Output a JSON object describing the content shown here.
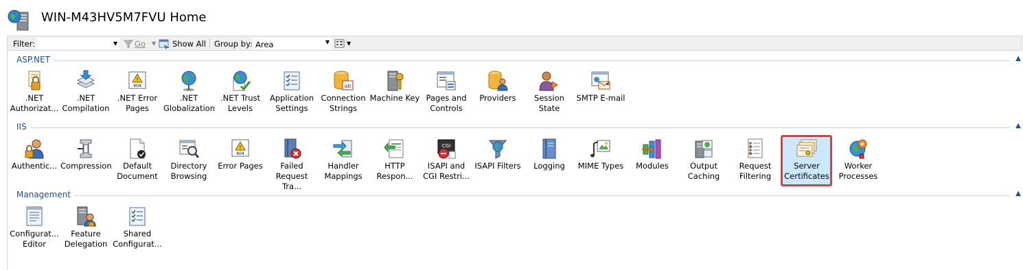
{
  "header": {
    "title": "WIN-M43HV5M7FVU Home"
  },
  "toolbar": {
    "filter_label": "Filter:",
    "filter_value": "",
    "go_label": "Go",
    "show_all_label": "Show All",
    "group_by_label": "Group by:",
    "group_by_value": "Area"
  },
  "groups": [
    {
      "name": "ASP.NET",
      "items": [
        {
          "line1": ".NET",
          "line2": "Authorizat..."
        },
        {
          "line1": ".NET",
          "line2": "Compilation"
        },
        {
          "line1": ".NET Error",
          "line2": "Pages"
        },
        {
          "line1": ".NET",
          "line2": "Globalization"
        },
        {
          "line1": ".NET Trust",
          "line2": "Levels"
        },
        {
          "line1": "Application",
          "line2": "Settings"
        },
        {
          "line1": "Connection",
          "line2": "Strings"
        },
        {
          "line1": "Machine Key",
          "line2": ""
        },
        {
          "line1": "Pages and",
          "line2": "Controls"
        },
        {
          "line1": "Providers",
          "line2": ""
        },
        {
          "line1": "Session State",
          "line2": ""
        },
        {
          "line1": "SMTP E-mail",
          "line2": ""
        }
      ]
    },
    {
      "name": "IIS",
      "items": [
        {
          "line1": "Authentic...",
          "line2": ""
        },
        {
          "line1": "Compression",
          "line2": ""
        },
        {
          "line1": "Default",
          "line2": "Document"
        },
        {
          "line1": "Directory",
          "line2": "Browsing"
        },
        {
          "line1": "Error Pages",
          "line2": ""
        },
        {
          "line1": "Failed",
          "line2": "Request Tra..."
        },
        {
          "line1": "Handler",
          "line2": "Mappings"
        },
        {
          "line1": "HTTP",
          "line2": "Respon..."
        },
        {
          "line1": "ISAPI and",
          "line2": "CGI Restri..."
        },
        {
          "line1": "ISAPI Filters",
          "line2": ""
        },
        {
          "line1": "Logging",
          "line2": ""
        },
        {
          "line1": "MIME Types",
          "line2": ""
        },
        {
          "line1": "Modules",
          "line2": ""
        },
        {
          "line1": "Output",
          "line2": "Caching"
        },
        {
          "line1": "Request",
          "line2": "Filtering"
        },
        {
          "line1": "Server",
          "line2": "Certificates"
        },
        {
          "line1": "Worker",
          "line2": "Processes"
        }
      ]
    },
    {
      "name": "Management",
      "items": [
        {
          "line1": "Configurat...",
          "line2": "Editor"
        },
        {
          "line1": "Feature",
          "line2": "Delegation"
        },
        {
          "line1": "Shared",
          "line2": "Configurat..."
        }
      ]
    }
  ],
  "colors": {
    "group_header": "#1e4e8c",
    "selection_fill": "#cce8ff",
    "selection_border": "#e53935"
  }
}
